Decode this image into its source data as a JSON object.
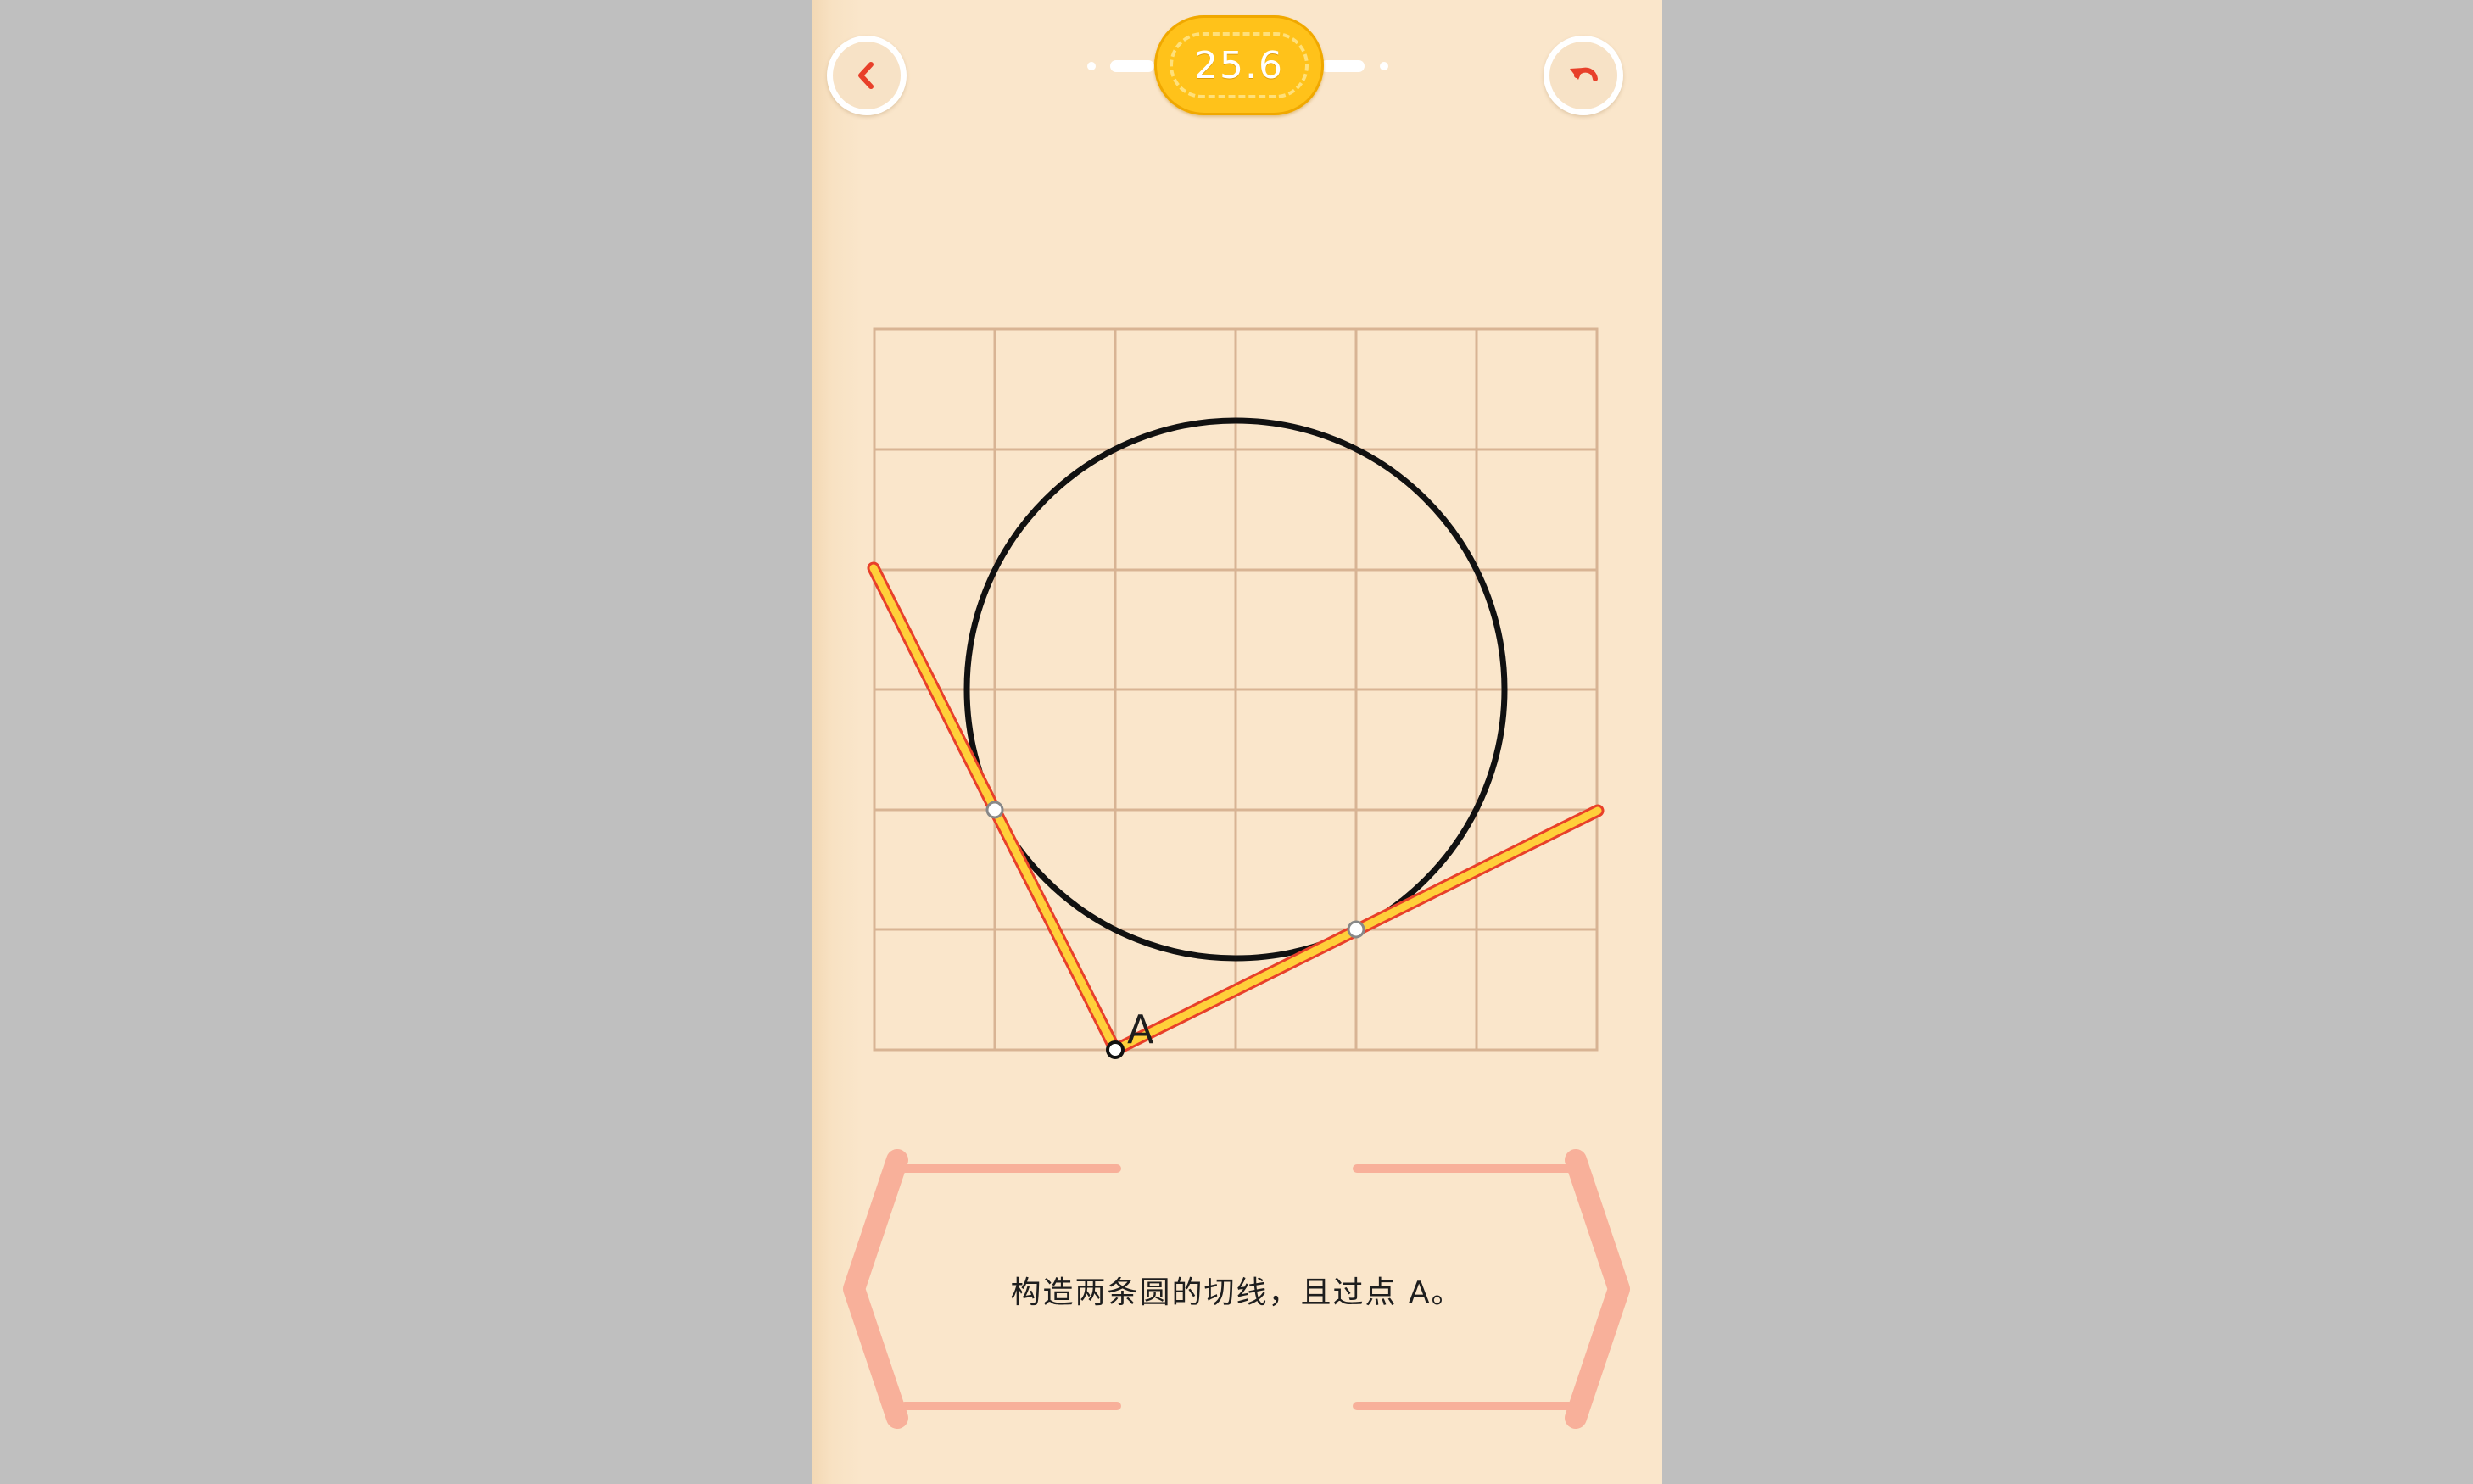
{
  "header": {
    "back_icon": "chevron-left-icon",
    "undo_icon": "undo-arrow-icon",
    "score": "25.6",
    "accent_color": "#e8402a",
    "badge_color": "#ffc21a"
  },
  "puzzle": {
    "point_label": "A",
    "grid_color": "#d8b494",
    "circle_color": "#111111",
    "line_color": "#ffcf3a",
    "line_edge_color": "#e8402a"
  },
  "hint": {
    "text": "构造两条圆的切线，且过点 A。"
  }
}
